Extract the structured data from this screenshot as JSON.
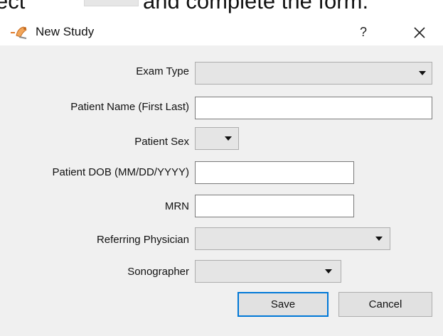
{
  "caption": {
    "text_left": "ect",
    "text_right": "and complete the form."
  },
  "dialog": {
    "title": "New Study",
    "help_label": "?",
    "app_icon": "ultrasound-probe-icon",
    "close_icon": "close-icon"
  },
  "form": {
    "exam_type": {
      "label": "Exam Type",
      "value": ""
    },
    "patient_name": {
      "label": "Patient Name (First Last)",
      "value": ""
    },
    "patient_sex": {
      "label": "Patient Sex",
      "value": ""
    },
    "patient_dob": {
      "label": "Patient DOB (MM/DD/YYYY)",
      "value": ""
    },
    "mrn": {
      "label": "MRN",
      "value": ""
    },
    "referring_physician": {
      "label": "Referring Physician",
      "value": ""
    },
    "sonographer": {
      "label": "Sonographer",
      "value": ""
    }
  },
  "buttons": {
    "save_label": "Save",
    "cancel_label": "Cancel"
  },
  "colors": {
    "default_button_border": "#0078d7",
    "dialog_background": "#f0f0f0"
  }
}
